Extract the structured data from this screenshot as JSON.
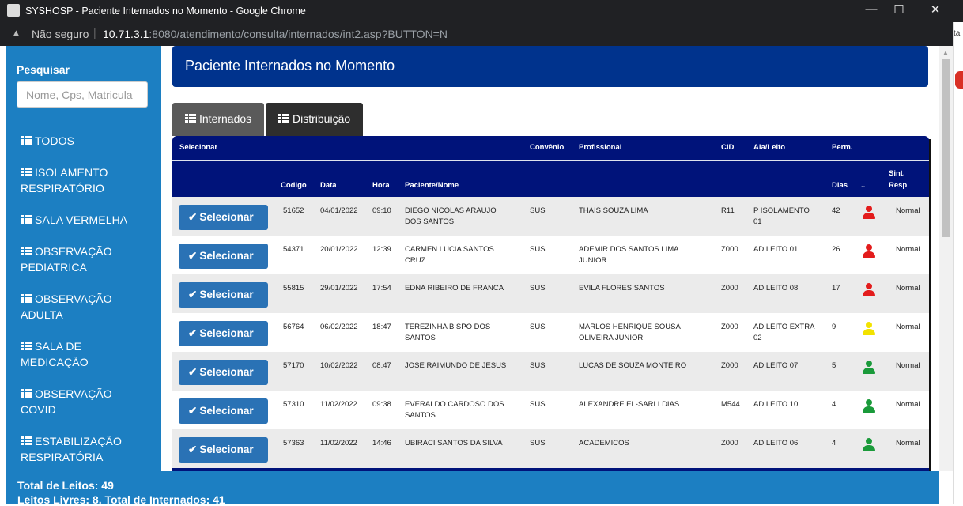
{
  "browser": {
    "window_title": "SYSHOSP - Paciente Internados no Momento - Google Chrome",
    "not_secure": "Não seguro",
    "url_host": "10.71.3.1",
    "url_rest": ":8080/atendimento/consulta/internados/int2.asp?BUTTON=N",
    "right_tab_text": "ta"
  },
  "sidebar": {
    "search_label": "Pesquisar",
    "search_placeholder": "Nome, Cps, Matricula",
    "items": [
      {
        "l1": "TODOS",
        "l2": ""
      },
      {
        "l1": "ISOLAMENTO",
        "l2": "RESPIRATÓRIO"
      },
      {
        "l1": "SALA VERMELHA",
        "l2": ""
      },
      {
        "l1": "OBSERVAÇÃO",
        "l2": "PEDIATRICA"
      },
      {
        "l1": "OBSERVAÇÃO",
        "l2": "ADULTA"
      },
      {
        "l1": "SALA DE",
        "l2": "MEDICAÇÃO"
      },
      {
        "l1": "OBSERVAÇÃO",
        "l2": "COVID"
      },
      {
        "l1": "ESTABILIZAÇÃO",
        "l2": "RESPIRATÓRIA"
      }
    ]
  },
  "footer": {
    "total_leitos": "Total de Leitos: 49",
    "livres_internados": "Leitos Livres: 8, Total de Internados: 41"
  },
  "page": {
    "title": "Paciente Internados no Momento",
    "tabs": [
      "Internados",
      "Distribuição"
    ]
  },
  "table": {
    "header_top": {
      "selecionar": "Selecionar",
      "convenio": "Convênio",
      "profissional": "Profissional",
      "cid": "CID",
      "ala_leito": "Ala/Leito",
      "perm": "Perm."
    },
    "header_bottom": {
      "codigo": "Codigo",
      "data": "Data",
      "hora": "Hora",
      "paciente": "Paciente/Nome",
      "dias": "Dias",
      "dots": "..",
      "sint_l1": "Sint.",
      "sint_l2": "Resp"
    },
    "select_label": "Selecionar",
    "status_colors": {
      "red": "#e31c1c",
      "yellow": "#f2e200",
      "green": "#1a9a3a"
    },
    "rows": [
      {
        "codigo": "51652",
        "data": "04/01/2022",
        "hora": "09:10",
        "paciente1": "DIEGO NICOLAS ARAUJO",
        "paciente2": "DOS SANTOS",
        "convenio": "SUS",
        "prof1": "THAIS SOUZA LIMA",
        "prof2": "",
        "cid": "R11",
        "ala1": "P ISOLAMENTO",
        "ala2": "01",
        "dias": "42",
        "status": "red",
        "sint": "Normal"
      },
      {
        "codigo": "54371",
        "data": "20/01/2022",
        "hora": "12:39",
        "paciente1": "CARMEN LUCIA SANTOS",
        "paciente2": "CRUZ",
        "convenio": "SUS",
        "prof1": "ADEMIR DOS SANTOS LIMA",
        "prof2": "JUNIOR",
        "cid": "Z000",
        "ala1": "AD LEITO 01",
        "ala2": "",
        "dias": "26",
        "status": "red",
        "sint": "Normal"
      },
      {
        "codigo": "55815",
        "data": "29/01/2022",
        "hora": "17:54",
        "paciente1": "EDNA RIBEIRO DE FRANCA",
        "paciente2": "",
        "convenio": "SUS",
        "prof1": "EVILA FLORES SANTOS",
        "prof2": "",
        "cid": "Z000",
        "ala1": "AD LEITO 08",
        "ala2": "",
        "dias": "17",
        "status": "red",
        "sint": "Normal"
      },
      {
        "codigo": "56764",
        "data": "06/02/2022",
        "hora": "18:47",
        "paciente1": "TEREZINHA BISPO DOS",
        "paciente2": "SANTOS",
        "convenio": "SUS",
        "prof1": "MARLOS HENRIQUE SOUSA",
        "prof2": "OLIVEIRA JUNIOR",
        "cid": "Z000",
        "ala1": "AD LEITO EXTRA",
        "ala2": "02",
        "dias": "9",
        "status": "yellow",
        "sint": "Normal"
      },
      {
        "codigo": "57170",
        "data": "10/02/2022",
        "hora": "08:47",
        "paciente1": "JOSE RAIMUNDO DE JESUS",
        "paciente2": "",
        "convenio": "SUS",
        "prof1": "LUCAS DE SOUZA MONTEIRO",
        "prof2": "",
        "cid": "Z000",
        "ala1": "AD LEITO 07",
        "ala2": "",
        "dias": "5",
        "status": "green",
        "sint": "Normal"
      },
      {
        "codigo": "57310",
        "data": "11/02/2022",
        "hora": "09:38",
        "paciente1": "EVERALDO CARDOSO DOS",
        "paciente2": "SANTOS",
        "convenio": "SUS",
        "prof1": "ALEXANDRE EL-SARLI DIAS",
        "prof2": "",
        "cid": "M544",
        "ala1": "AD LEITO 10",
        "ala2": "",
        "dias": "4",
        "status": "green",
        "sint": "Normal"
      },
      {
        "codigo": "57363",
        "data": "11/02/2022",
        "hora": "14:46",
        "paciente1": "UBIRACI SANTOS DA SILVA",
        "paciente2": "",
        "convenio": "SUS",
        "prof1": "ACADEMICOS",
        "prof2": "",
        "cid": "Z000",
        "ala1": "AD LEITO 06",
        "ala2": "",
        "dias": "4",
        "status": "green",
        "sint": "Normal"
      }
    ]
  }
}
